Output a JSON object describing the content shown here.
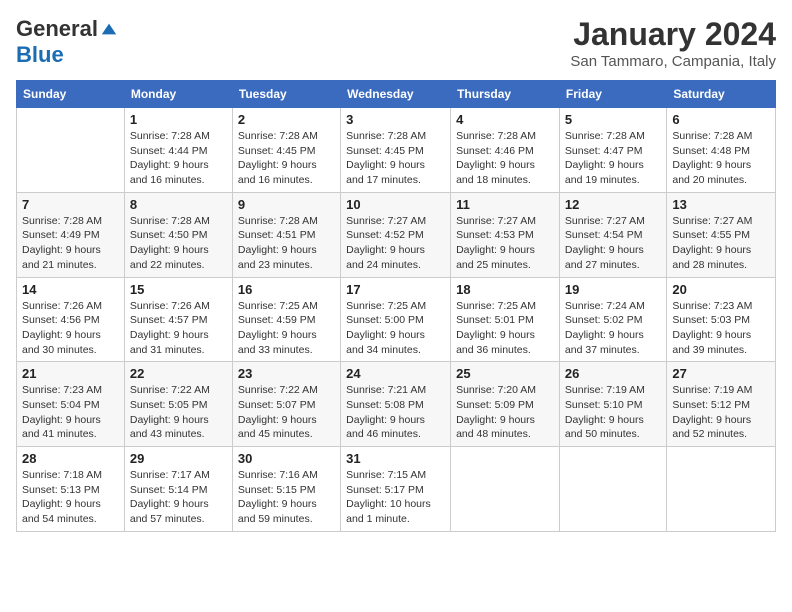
{
  "logo": {
    "general": "General",
    "blue": "Blue"
  },
  "title": "January 2024",
  "location": "San Tammaro, Campania, Italy",
  "headers": [
    "Sunday",
    "Monday",
    "Tuesday",
    "Wednesday",
    "Thursday",
    "Friday",
    "Saturday"
  ],
  "weeks": [
    [
      {
        "day": "",
        "info": ""
      },
      {
        "day": "1",
        "info": "Sunrise: 7:28 AM\nSunset: 4:44 PM\nDaylight: 9 hours\nand 16 minutes."
      },
      {
        "day": "2",
        "info": "Sunrise: 7:28 AM\nSunset: 4:45 PM\nDaylight: 9 hours\nand 16 minutes."
      },
      {
        "day": "3",
        "info": "Sunrise: 7:28 AM\nSunset: 4:45 PM\nDaylight: 9 hours\nand 17 minutes."
      },
      {
        "day": "4",
        "info": "Sunrise: 7:28 AM\nSunset: 4:46 PM\nDaylight: 9 hours\nand 18 minutes."
      },
      {
        "day": "5",
        "info": "Sunrise: 7:28 AM\nSunset: 4:47 PM\nDaylight: 9 hours\nand 19 minutes."
      },
      {
        "day": "6",
        "info": "Sunrise: 7:28 AM\nSunset: 4:48 PM\nDaylight: 9 hours\nand 20 minutes."
      }
    ],
    [
      {
        "day": "7",
        "info": "Sunrise: 7:28 AM\nSunset: 4:49 PM\nDaylight: 9 hours\nand 21 minutes."
      },
      {
        "day": "8",
        "info": "Sunrise: 7:28 AM\nSunset: 4:50 PM\nDaylight: 9 hours\nand 22 minutes."
      },
      {
        "day": "9",
        "info": "Sunrise: 7:28 AM\nSunset: 4:51 PM\nDaylight: 9 hours\nand 23 minutes."
      },
      {
        "day": "10",
        "info": "Sunrise: 7:27 AM\nSunset: 4:52 PM\nDaylight: 9 hours\nand 24 minutes."
      },
      {
        "day": "11",
        "info": "Sunrise: 7:27 AM\nSunset: 4:53 PM\nDaylight: 9 hours\nand 25 minutes."
      },
      {
        "day": "12",
        "info": "Sunrise: 7:27 AM\nSunset: 4:54 PM\nDaylight: 9 hours\nand 27 minutes."
      },
      {
        "day": "13",
        "info": "Sunrise: 7:27 AM\nSunset: 4:55 PM\nDaylight: 9 hours\nand 28 minutes."
      }
    ],
    [
      {
        "day": "14",
        "info": "Sunrise: 7:26 AM\nSunset: 4:56 PM\nDaylight: 9 hours\nand 30 minutes."
      },
      {
        "day": "15",
        "info": "Sunrise: 7:26 AM\nSunset: 4:57 PM\nDaylight: 9 hours\nand 31 minutes."
      },
      {
        "day": "16",
        "info": "Sunrise: 7:25 AM\nSunset: 4:59 PM\nDaylight: 9 hours\nand 33 minutes."
      },
      {
        "day": "17",
        "info": "Sunrise: 7:25 AM\nSunset: 5:00 PM\nDaylight: 9 hours\nand 34 minutes."
      },
      {
        "day": "18",
        "info": "Sunrise: 7:25 AM\nSunset: 5:01 PM\nDaylight: 9 hours\nand 36 minutes."
      },
      {
        "day": "19",
        "info": "Sunrise: 7:24 AM\nSunset: 5:02 PM\nDaylight: 9 hours\nand 37 minutes."
      },
      {
        "day": "20",
        "info": "Sunrise: 7:23 AM\nSunset: 5:03 PM\nDaylight: 9 hours\nand 39 minutes."
      }
    ],
    [
      {
        "day": "21",
        "info": "Sunrise: 7:23 AM\nSunset: 5:04 PM\nDaylight: 9 hours\nand 41 minutes."
      },
      {
        "day": "22",
        "info": "Sunrise: 7:22 AM\nSunset: 5:05 PM\nDaylight: 9 hours\nand 43 minutes."
      },
      {
        "day": "23",
        "info": "Sunrise: 7:22 AM\nSunset: 5:07 PM\nDaylight: 9 hours\nand 45 minutes."
      },
      {
        "day": "24",
        "info": "Sunrise: 7:21 AM\nSunset: 5:08 PM\nDaylight: 9 hours\nand 46 minutes."
      },
      {
        "day": "25",
        "info": "Sunrise: 7:20 AM\nSunset: 5:09 PM\nDaylight: 9 hours\nand 48 minutes."
      },
      {
        "day": "26",
        "info": "Sunrise: 7:19 AM\nSunset: 5:10 PM\nDaylight: 9 hours\nand 50 minutes."
      },
      {
        "day": "27",
        "info": "Sunrise: 7:19 AM\nSunset: 5:12 PM\nDaylight: 9 hours\nand 52 minutes."
      }
    ],
    [
      {
        "day": "28",
        "info": "Sunrise: 7:18 AM\nSunset: 5:13 PM\nDaylight: 9 hours\nand 54 minutes."
      },
      {
        "day": "29",
        "info": "Sunrise: 7:17 AM\nSunset: 5:14 PM\nDaylight: 9 hours\nand 57 minutes."
      },
      {
        "day": "30",
        "info": "Sunrise: 7:16 AM\nSunset: 5:15 PM\nDaylight: 9 hours\nand 59 minutes."
      },
      {
        "day": "31",
        "info": "Sunrise: 7:15 AM\nSunset: 5:17 PM\nDaylight: 10 hours\nand 1 minute."
      },
      {
        "day": "",
        "info": ""
      },
      {
        "day": "",
        "info": ""
      },
      {
        "day": "",
        "info": ""
      }
    ]
  ]
}
